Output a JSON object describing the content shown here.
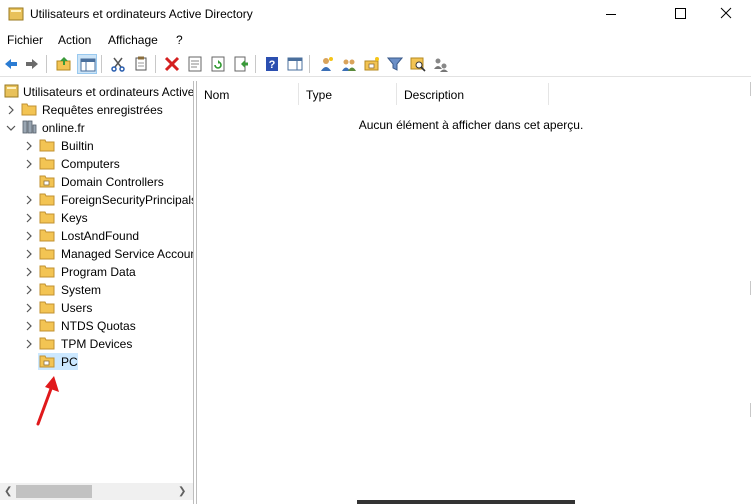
{
  "window": {
    "title": "Utilisateurs et ordinateurs Active Directory",
    "minimize_glyph": "—",
    "maximize_glyph": "☐",
    "close_glyph": "✕"
  },
  "menu": {
    "items": [
      "Fichier",
      "Action",
      "Affichage",
      "?"
    ]
  },
  "toolbar": {
    "buttons": [
      "back-icon",
      "forward-icon",
      "up-folder-icon",
      "show-console-tree-icon",
      "cut-icon",
      "copy-icon",
      "delete-icon",
      "properties-icon",
      "refresh-icon",
      "export-list-icon",
      "help-icon",
      "action-pane-icon",
      "new-user-icon",
      "new-group-icon",
      "new-ou-icon",
      "filter-icon",
      "find-icon",
      "add-to-group-icon"
    ]
  },
  "tree": {
    "root": "Utilisateurs et ordinateurs Active Directory",
    "saved_queries": "Requêtes enregistrées",
    "domain": "online.fr",
    "children": [
      "Builtin",
      "Computers",
      "Domain Controllers",
      "ForeignSecurityPrincipals",
      "Keys",
      "LostAndFound",
      "Managed Service Accounts",
      "Program Data",
      "System",
      "Users",
      "NTDS Quotas",
      "TPM Devices",
      "PC"
    ],
    "selected": "PC"
  },
  "list": {
    "columns": [
      "Nom",
      "Type",
      "Description"
    ],
    "empty_message": "Aucun élément à afficher dans cet aperçu."
  },
  "colors": {
    "selection": "#cce8ff",
    "annotation_arrow": "#e0191b",
    "folder": "#f3c453"
  }
}
